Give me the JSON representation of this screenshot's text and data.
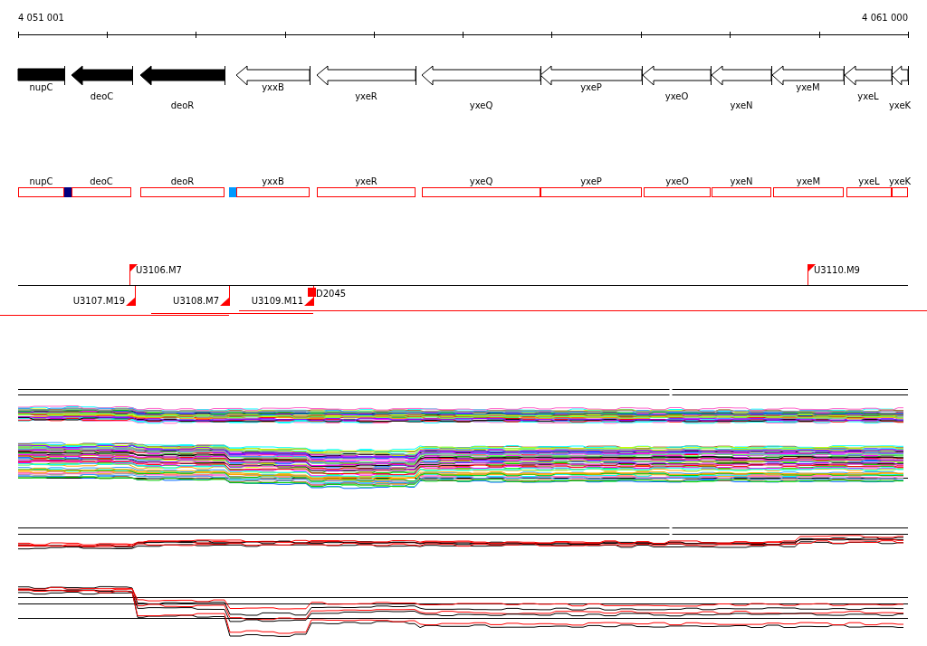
{
  "axis": {
    "start_label": "4 051 001",
    "end_label": "4 061 000"
  },
  "genes": [
    {
      "name": "nupC",
      "filled": true,
      "head": false
    },
    {
      "name": "deoC",
      "filled": true,
      "head": true
    },
    {
      "name": "deoR",
      "filled": true,
      "head": true
    },
    {
      "name": "yxxB",
      "filled": false,
      "head": true
    },
    {
      "name": "yxeR",
      "filled": false,
      "head": true
    },
    {
      "name": "yxeQ",
      "filled": false,
      "head": true
    },
    {
      "name": "yxeP",
      "filled": false,
      "head": true
    },
    {
      "name": "yxeO",
      "filled": false,
      "head": true
    },
    {
      "name": "yxeN",
      "filled": false,
      "head": true
    },
    {
      "name": "yxeM",
      "filled": false,
      "head": true
    },
    {
      "name": "yxeL",
      "filled": false,
      "head": true
    },
    {
      "name": "yxeK",
      "filled": false,
      "head": true
    }
  ],
  "segments": [
    "nupC",
    "deoC",
    "deoR",
    "yxxB",
    "yxeR",
    "yxeQ",
    "yxeP",
    "yxeO",
    "yxeN",
    "yxeM",
    "yxeL",
    "yxeK"
  ],
  "segment_markers": [
    {
      "color": "#000080"
    },
    {
      "color": "#0099ff"
    }
  ],
  "features_above": [
    "U3106.M7",
    "U3110.M9"
  ],
  "features_below": [
    "U3107.M19",
    "U3108.M7",
    "U3109.M11",
    "D2045"
  ]
}
